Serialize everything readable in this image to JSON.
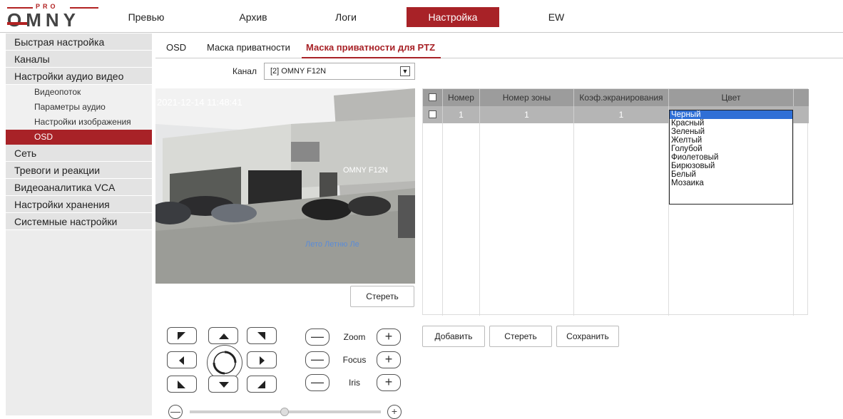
{
  "logo": {
    "sub": "PRO",
    "word": "OMNY"
  },
  "nav": [
    "Превью",
    "Архив",
    "Логи",
    "Настройка",
    "EW"
  ],
  "sidebar": {
    "items": [
      "Быстрая настройка",
      "Каналы",
      "Настройки аудио видео"
    ],
    "subitems": [
      "Видеопоток",
      "Параметры аудио",
      "Настройки изображения",
      "OSD"
    ],
    "items2": [
      "Сеть",
      "Тревоги и реакции",
      "Видеоаналитика VCA",
      "Настройки хранения",
      "Системные настройки"
    ]
  },
  "tabs": [
    "OSD",
    "Маска приватности",
    "Маска приватности для PTZ"
  ],
  "channel": {
    "label": "Канал",
    "value": "[2] OMNY F12N"
  },
  "video": {
    "osd_time": "2021-12-14 11:48:41",
    "camera_name": "OMNY F12N",
    "overlay": "Лето Летню Ле"
  },
  "buttons": {
    "erase": "Стереть",
    "add": "Добавить",
    "erase2": "Стереть",
    "save": "Сохранить"
  },
  "ptz": {
    "zoom": "Zoom",
    "focus": "Focus",
    "iris": "Iris",
    "minus": "—",
    "plus": "+"
  },
  "table": {
    "headers": [
      "Номер",
      "Номер зоны",
      "Коэф.экранирования",
      "Цвет"
    ],
    "row": [
      "1",
      "1",
      "1"
    ]
  },
  "colors": [
    "Черный",
    "Красный",
    "Зеленый",
    "Желтый",
    "Голубой",
    "Фиолетовый",
    "Бирюзовый",
    "Белый",
    "Мозаика"
  ],
  "accent": "#a82227"
}
